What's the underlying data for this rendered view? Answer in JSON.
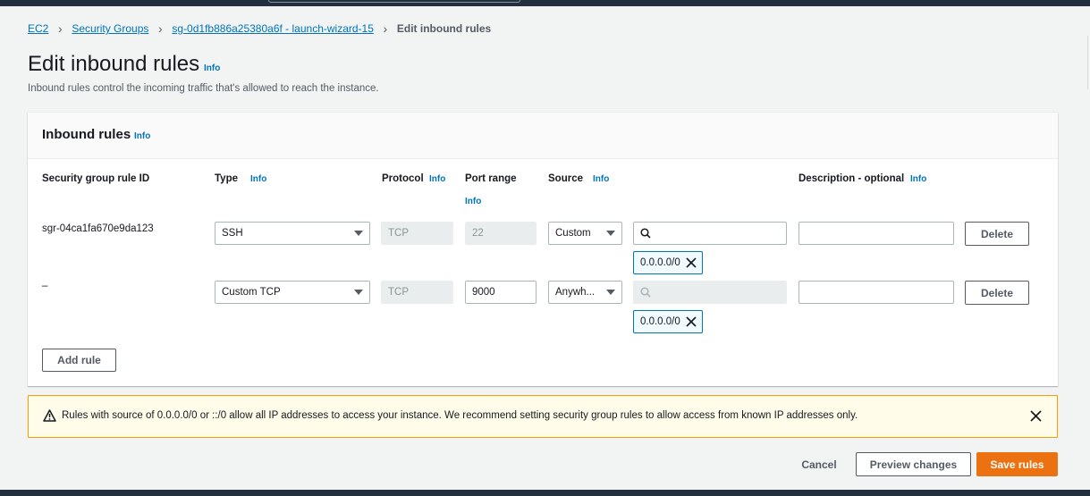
{
  "breadcrumb": {
    "items": [
      "EC2",
      "Security Groups",
      "sg-0d1fb886a25380a6f - launch-wizard-15"
    ],
    "current": "Edit inbound rules"
  },
  "page": {
    "title": "Edit inbound rules",
    "info": "Info",
    "description": "Inbound rules control the incoming traffic that's allowed to reach the instance."
  },
  "panel": {
    "title": "Inbound rules",
    "info": "Info",
    "columns": {
      "rule_id": "Security group rule ID",
      "type": "Type",
      "protocol": "Protocol",
      "port_range": "Port range",
      "source": "Source",
      "description": "Description - optional",
      "info": "Info"
    },
    "rows": [
      {
        "rule_id": "sgr-04ca1fa670e9da123",
        "type": "SSH",
        "protocol": "TCP",
        "port_range": "22",
        "source": "Custom",
        "search_value": "",
        "token": "0.0.0.0/0",
        "description": "",
        "delete": "Delete"
      },
      {
        "rule_id": "–",
        "type": "Custom TCP",
        "protocol": "TCP",
        "port_range": "9000",
        "source": "Anywh...",
        "search_value": "",
        "token": "0.0.0.0/0",
        "description": "",
        "delete": "Delete"
      }
    ],
    "add_rule": "Add rule"
  },
  "alert": {
    "message": "Rules with source of 0.0.0.0/0 or ::/0 allow all IP addresses to access your instance. We recommend setting security group rules to allow access from known IP addresses only."
  },
  "footer": {
    "cancel": "Cancel",
    "preview": "Preview changes",
    "save": "Save rules"
  },
  "colors": {
    "link": "#0073bb",
    "primary": "#ec7211",
    "warning_border": "#ff9900",
    "warning_bg": "#fffce9",
    "topbar": "#232f3e"
  },
  "icons": [
    "chevron-right-icon",
    "caret-down-icon",
    "search-icon",
    "close-icon",
    "warning-icon"
  ]
}
